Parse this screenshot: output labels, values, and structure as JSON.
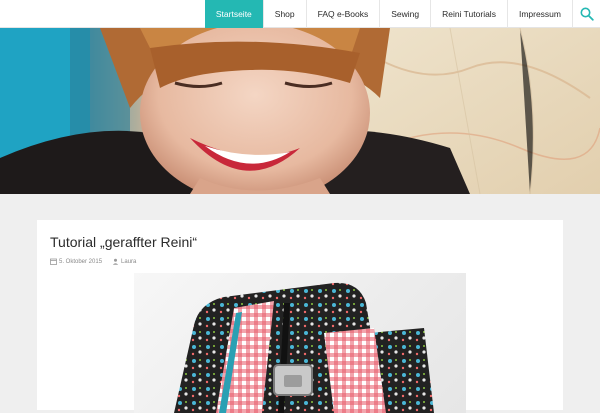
{
  "nav": {
    "items": [
      {
        "label": "Startseite",
        "active": true
      },
      {
        "label": "Shop"
      },
      {
        "label": "FAQ e-Books"
      },
      {
        "label": "Sewing"
      },
      {
        "label": "Reini Tutorials"
      },
      {
        "label": "Impressum"
      }
    ],
    "search_icon": "search-icon",
    "accent_color": "#24b8b3"
  },
  "post": {
    "title": "Tutorial „geraffter Reini“",
    "date": "5. Oktober 2015",
    "author": "Laura",
    "date_icon": "calendar-icon",
    "author_icon": "user-icon"
  }
}
